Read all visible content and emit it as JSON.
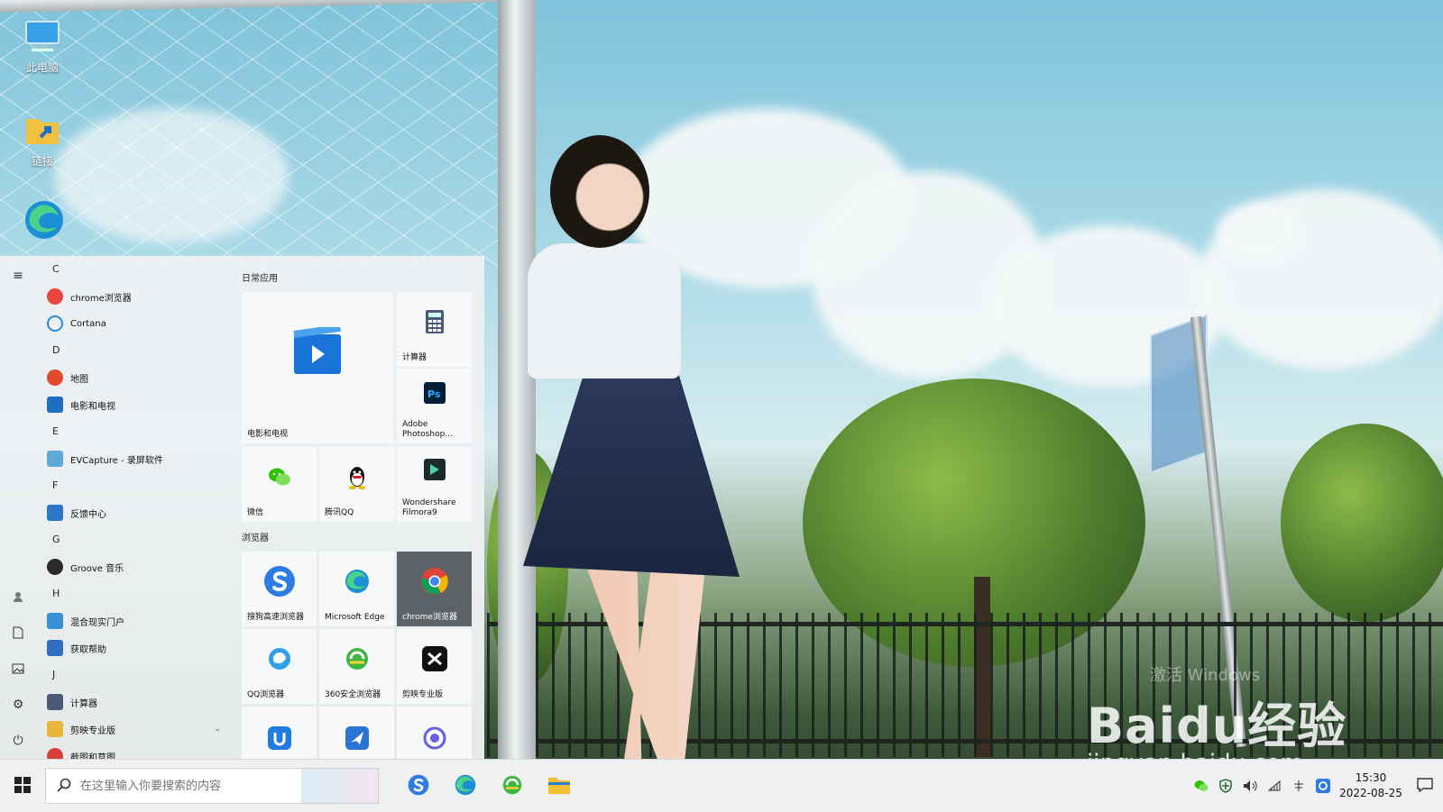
{
  "desktop": {
    "icons": [
      {
        "label": "此电脑",
        "icon": "computer-icon"
      },
      {
        "label": "链接",
        "icon": "folder-shortcut-icon"
      },
      {
        "label": "",
        "icon": "edge-icon"
      }
    ]
  },
  "start_menu": {
    "app_list": [
      {
        "type": "letter",
        "label": "C"
      },
      {
        "type": "app",
        "label": "chrome浏览器",
        "icon": "chrome-icon",
        "color": "#e8453c"
      },
      {
        "type": "app",
        "label": "Cortana",
        "icon": "cortana-icon",
        "color": "#2a8ad4"
      },
      {
        "type": "letter",
        "label": "D"
      },
      {
        "type": "app",
        "label": "地图",
        "icon": "map-pin-icon",
        "color": "#e2492f"
      },
      {
        "type": "app",
        "label": "电影和电视",
        "icon": "movies-icon",
        "color": "#1e6fc4"
      },
      {
        "type": "letter",
        "label": "E"
      },
      {
        "type": "app",
        "label": "EVCapture - 录屏软件",
        "icon": "evcapture-icon",
        "color": "#5fa9d8"
      },
      {
        "type": "letter",
        "label": "F"
      },
      {
        "type": "app",
        "label": "反馈中心",
        "icon": "feedback-icon",
        "color": "#2d77c7"
      },
      {
        "type": "letter",
        "label": "G"
      },
      {
        "type": "app",
        "label": "Groove 音乐",
        "icon": "groove-icon",
        "color": "#2b2b2b"
      },
      {
        "type": "letter",
        "label": "H"
      },
      {
        "type": "app",
        "label": "混合现实门户",
        "icon": "mixed-reality-icon",
        "color": "#3a8fd6"
      },
      {
        "type": "app",
        "label": "获取帮助",
        "icon": "help-icon",
        "color": "#2f6fc2"
      },
      {
        "type": "letter",
        "label": "J"
      },
      {
        "type": "app",
        "label": "计算器",
        "icon": "calculator-icon",
        "color": "#4a5a78"
      },
      {
        "type": "app",
        "label": "剪映专业版",
        "icon": "folder-icon",
        "color": "#e9b53a",
        "expandable": true
      },
      {
        "type": "app",
        "label": "截图和草图",
        "icon": "snip-icon",
        "color": "#d8413b"
      }
    ],
    "groups": [
      {
        "title": "日常应用"
      },
      {
        "title": "浏览器"
      }
    ],
    "tiles_daily": [
      {
        "label": "电影和电视",
        "icon": "movies-icon"
      },
      {
        "label": "计算器",
        "icon": "calculator-icon"
      },
      {
        "label": "Adobe Photoshop...",
        "icon": "photoshop-icon"
      },
      {
        "label": "微信",
        "icon": "wechat-icon"
      },
      {
        "label": "腾讯QQ",
        "icon": "qq-icon"
      },
      {
        "label": "Wondershare Filmora9",
        "icon": "filmora-icon"
      }
    ],
    "tiles_browser": [
      {
        "label": "搜狗高速浏览器",
        "icon": "sogou-icon"
      },
      {
        "label": "Microsoft Edge",
        "icon": "edge-icon"
      },
      {
        "label": "chrome浏览器",
        "icon": "chrome-icon",
        "selected": true
      },
      {
        "label": "QQ浏览器",
        "icon": "qq-browser-icon"
      },
      {
        "label": "360安全浏览器",
        "icon": "360-browser-icon"
      },
      {
        "label": "剪映专业版",
        "icon": "jianying-icon"
      },
      {
        "label": "",
        "icon": "app-u-icon"
      },
      {
        "label": "",
        "icon": "app-bird-icon"
      },
      {
        "label": "",
        "icon": "app-circle-icon"
      }
    ]
  },
  "taskbar": {
    "search_placeholder": "在这里输入你要搜索的内容",
    "pinned": [
      "sogou-icon",
      "edge-icon",
      "360-browser-icon",
      "file-explorer-icon"
    ],
    "clock_time": "15:30",
    "clock_date": "2022-08-25"
  },
  "watermark": {
    "logo": "Baidu经验",
    "url": "jingyan.baidu.com",
    "overlay": "激活 Windows"
  },
  "colors": {
    "start_bg": "#eef0f2",
    "tile_bg": "#f7f8fa",
    "tile_selected": "#5b6268",
    "taskbar_bg": "#eef0f2"
  }
}
